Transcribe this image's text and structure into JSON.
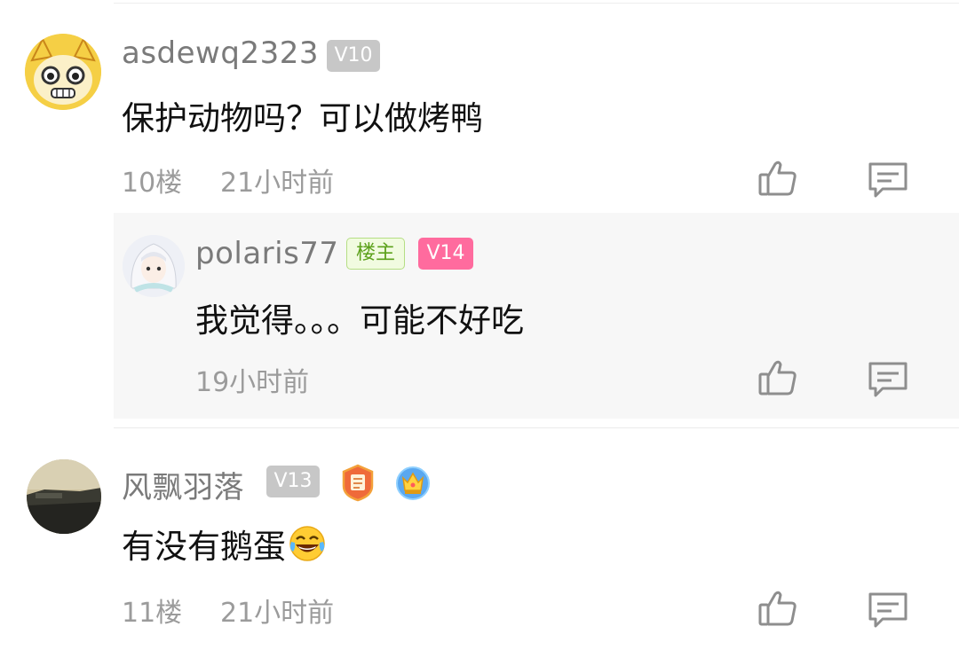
{
  "comments": [
    {
      "username": "asdewq2323",
      "level": "V10",
      "text": "保护动物吗？可以做烤鸭",
      "floor": "10楼",
      "time": "21小时前",
      "reply": {
        "username": "polaris77",
        "host_badge": "楼主",
        "level": "V14",
        "text": "我觉得。。。可能不好吃",
        "time": "19小时前"
      }
    },
    {
      "username": "风飘羽落",
      "level": "V13",
      "text": "有没有鹅蛋",
      "emoji": "laughing-tears-emoji",
      "floor": "11楼",
      "time": "21小时前"
    }
  ],
  "icons": {
    "like": "thumbs-up-icon",
    "comment": "comment-bubble-icon"
  },
  "colors": {
    "pink_badge": "#ff6b9e",
    "host_badge_text": "#5ca11b",
    "level_badge": "#c7c7c7"
  }
}
